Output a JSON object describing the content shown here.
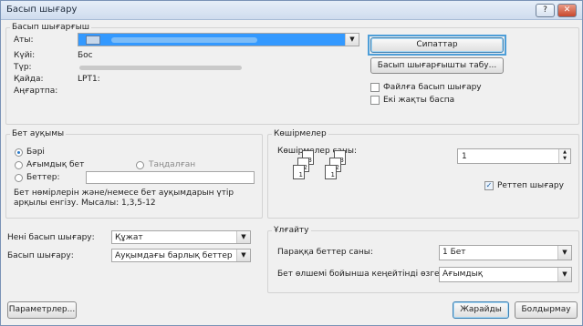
{
  "window": {
    "title": "Басып шығару",
    "help": "?",
    "close": "✕"
  },
  "printer": {
    "group_label": "Басып шығарғыш",
    "name_label": "Аты:",
    "status_label": "Күйі:",
    "status_value": "Бос",
    "type_label": "Түр:",
    "where_label": "Қайда:",
    "where_value": "LPT1:",
    "comment_label": "Аңғартпа:",
    "properties_button": "Сипаттар",
    "find_button": "Басып шығарғышты табу...",
    "print_to_file": "Файлға басып шығару",
    "duplex": "Екі жақты баспа"
  },
  "page_range": {
    "group_label": "Бет ауқымы",
    "all": "Бәрі",
    "current": "Ағымдық бет",
    "selection": "Таңдалған",
    "pages": "Беттер:",
    "hint": "Бет нөмірлерін және/немесе бет ауқымдарын үтір арқылы енгізу. Мысалы: 1,3,5-12"
  },
  "copies": {
    "group_label": "Көшірмелер",
    "count_label": "Көшірмелер саны:",
    "count_value": "1",
    "collate": "Реттеп шығару",
    "page_nums": [
      "1",
      "2",
      "3",
      "1",
      "2",
      "3"
    ]
  },
  "print_what": {
    "label": "Нені басып шығару:",
    "value": "Құжат"
  },
  "print": {
    "label": "Басып шығару:",
    "value": "Ауқымдағы барлық беттер"
  },
  "zoom": {
    "group_label": "Ұлғайту",
    "pages_per_sheet_label": "Параққа беттер саны:",
    "pages_per_sheet_value": "1 Бет",
    "scale_label": "Бет өлшемі бойынша кеңейтінді өзгерту:",
    "scale_value": "Ағымдық"
  },
  "footer": {
    "options": "Параметрлер...",
    "ok": "Жарайды",
    "cancel": "Болдырмау"
  }
}
